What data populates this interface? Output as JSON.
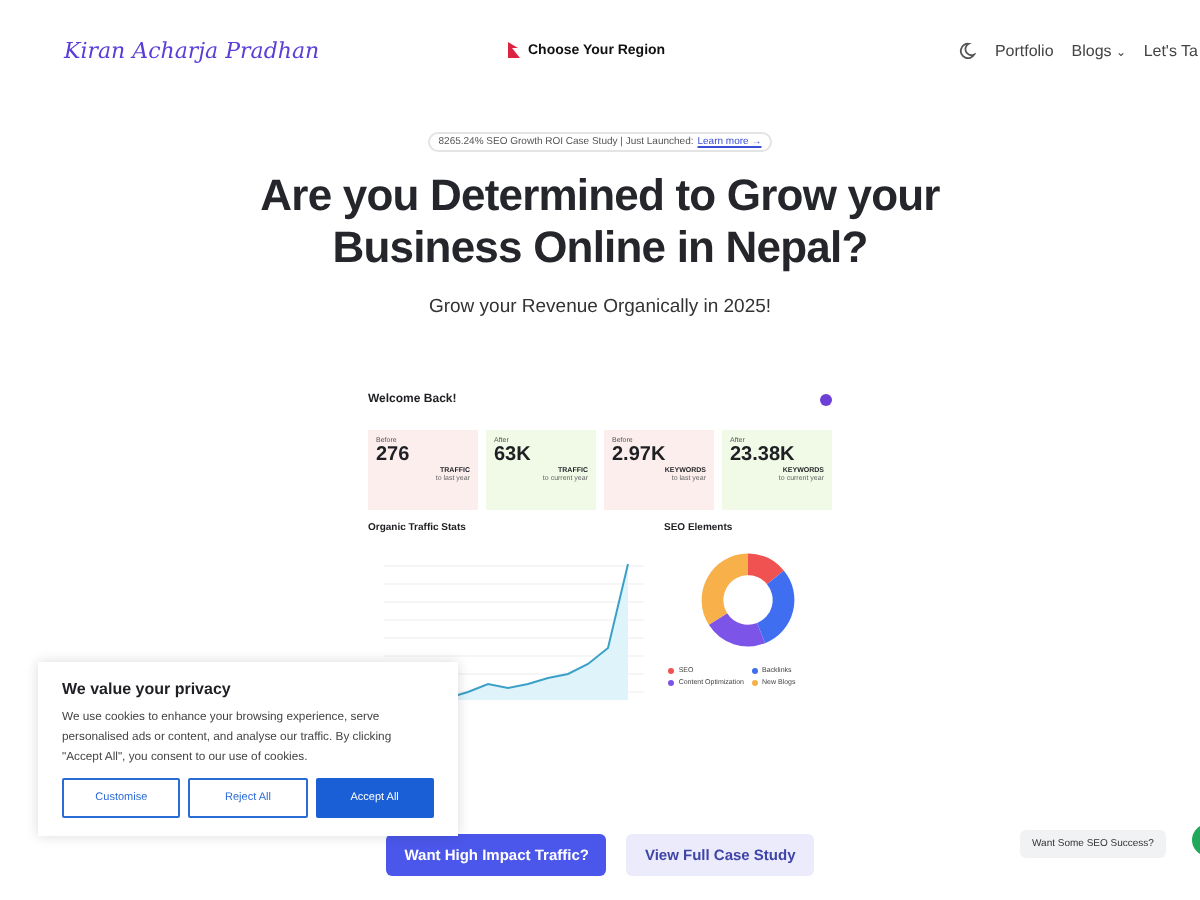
{
  "header": {
    "logo": "Kiran Acharja Pradhan",
    "region": "Choose Your Region",
    "nav": [
      {
        "label": "Portfolio"
      },
      {
        "label": "Blogs",
        "caret": "⌄"
      },
      {
        "label": "Let's Ta"
      }
    ]
  },
  "announcement": {
    "text": "8265.24% SEO Growth ROI Case Study | Just Launched:",
    "link": "Learn more →"
  },
  "hero": {
    "title_lines": [
      "Are you Determined to Grow your",
      "Business Online in Nepal?"
    ],
    "subtitle": "Grow your Revenue Organically in 2025!"
  },
  "dashboard": {
    "title": "Welcome Back!",
    "stats": [
      {
        "period": "Before",
        "value": "276",
        "metric": "TRAFFIC",
        "note": "to last year",
        "color": "#fdeeee"
      },
      {
        "period": "After",
        "value": "63K",
        "metric": "TRAFFIC",
        "note": "to current year",
        "color": "#f1fae6"
      },
      {
        "period": "Before",
        "value": "2.97K",
        "metric": "KEYWORDS",
        "note": "to last year",
        "color": "#fdeeee"
      },
      {
        "period": "After",
        "value": "23.38K",
        "metric": "KEYWORDS",
        "note": "to current year",
        "color": "#f1fae6"
      }
    ],
    "traffic": {
      "title": "Organic Traffic Stats"
    },
    "seo": {
      "title": "SEO Elements",
      "legend": [
        {
          "label": "SEO",
          "color": "#f05252"
        },
        {
          "label": "Backlinks",
          "color": "#3f6ff0"
        },
        {
          "label": "Content Optimization",
          "color": "#7c55e8"
        },
        {
          "label": "New Blogs",
          "color": "#f7b04a"
        }
      ]
    }
  },
  "cta": [
    {
      "label": "Want High Impact Traffic?",
      "kind": "primary"
    },
    {
      "label": "View Full Case Study",
      "kind": "secondary"
    }
  ],
  "cookie": {
    "title": "We value your privacy",
    "text": "We use cookies to enhance your browsing experience, serve personalised ads or content, and analyse our traffic. By clicking \"Accept All\", you consent to our use of cookies.",
    "buttons": [
      {
        "label": "Customise",
        "kind": "outline"
      },
      {
        "label": "Reject All",
        "kind": "outline"
      },
      {
        "label": "Accept All",
        "kind": "primary"
      }
    ]
  },
  "chat": {
    "label": "Want Some SEO Success?"
  }
}
